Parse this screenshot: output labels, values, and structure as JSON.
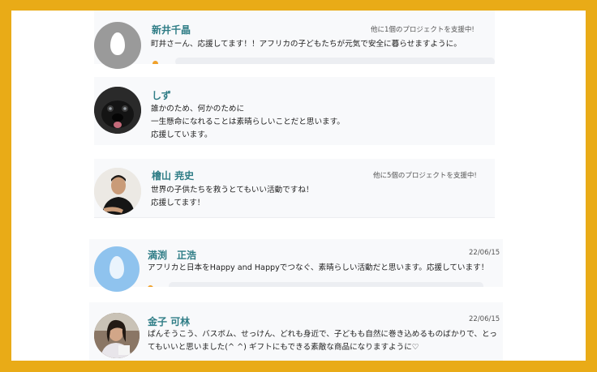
{
  "comments": [
    {
      "name": "新井千晶",
      "meta": "他に1個のプロジェクトを支援中!",
      "lines": [
        "町井さーん、応援してます！！アフリカの子どもたちが元気で安全に暮らせますように。"
      ],
      "avatar": "default-avatar-icon"
    },
    {
      "name": "しず",
      "meta": "",
      "lines": [
        "誰かのため、何かのために",
        "一生懸命になれることは素晴らしいことだと思います。",
        "応援しています。"
      ],
      "avatar": "dog-photo-avatar"
    },
    {
      "name": "檜山 尭史",
      "meta": "他に5個のプロジェクトを支援中!",
      "lines": [
        "世界の子供たちを救うとてもいい活動ですね！",
        "応援してます！"
      ],
      "avatar": "man-photo-avatar"
    },
    {
      "name": "満渕　正浩",
      "meta": "22/06/15",
      "lines": [
        "アフリカと日本をHappy and Happyでつなぐ、素晴らしい活動だと思います。応援しています！"
      ],
      "avatar": "default-avatar-icon"
    },
    {
      "name": "金子 可林",
      "meta": "22/06/15",
      "lines": [
        "ぱんそうこう、バスボム、せっけん、どれも身近で、子どもも自然に巻き込めるものばかりで、とっ",
        "てもいいと思いました(^ ^) ギフトにもできる素敵な商品になりますように♡"
      ],
      "avatar": "woman-photo-avatar"
    }
  ],
  "colors": {
    "background": "#e9ab17",
    "name": "#2f7d86",
    "card": "#f8f9fb"
  }
}
